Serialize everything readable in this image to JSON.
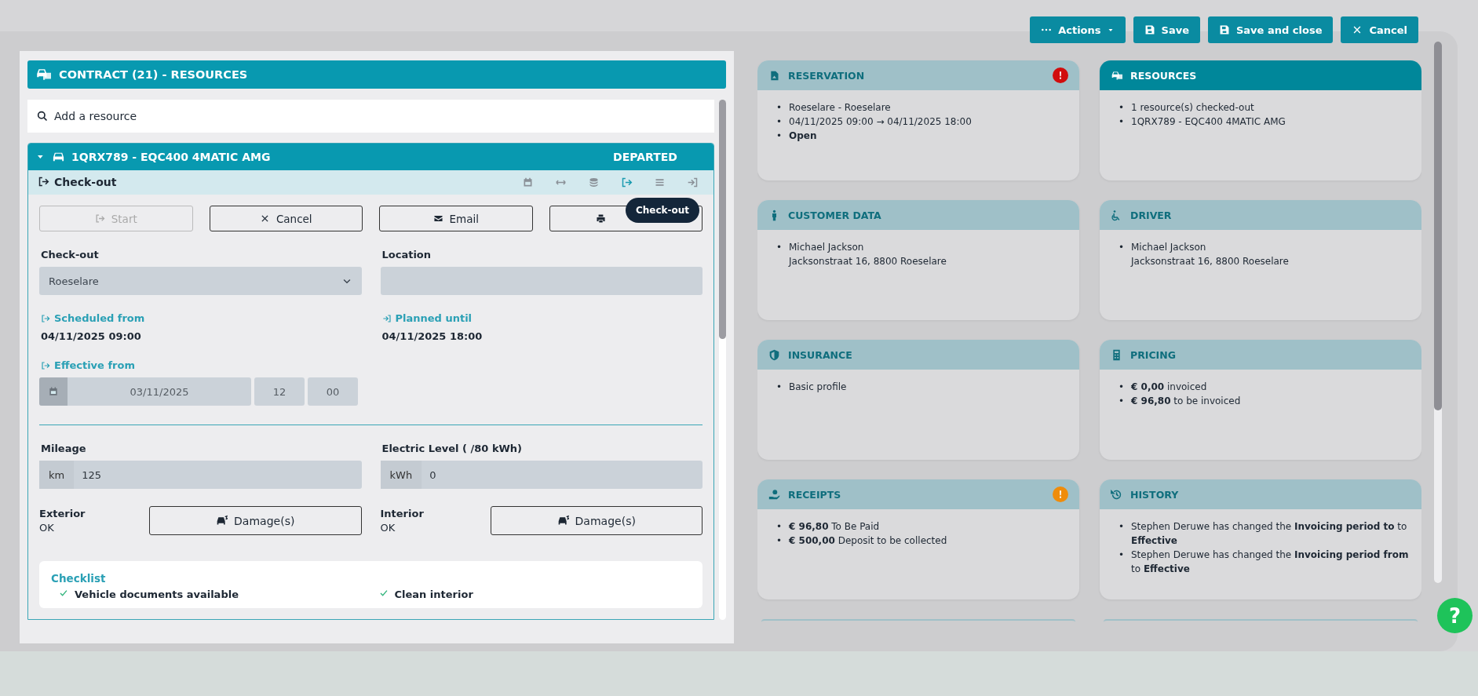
{
  "toolbar": {
    "buttons": [
      {
        "label": "Actions",
        "kind": "actions"
      },
      {
        "label": "Save",
        "kind": "save"
      },
      {
        "label": "Save and close",
        "kind": "save"
      },
      {
        "label": "Cancel",
        "kind": "cancel"
      }
    ]
  },
  "resources_panel": {
    "title": "CONTRACT (21) - RESOURCES",
    "search": {
      "placeholder": "Add a resource"
    },
    "resource": {
      "title": "1QRX789 - EQC400 4MATIC AMG",
      "status": "DEPARTED",
      "expanded": true,
      "section_title": "Check-out",
      "tools": [
        {
          "kind": "calendar",
          "selected": false
        },
        {
          "kind": "resize",
          "selected": false
        },
        {
          "kind": "coins",
          "selected": false
        },
        {
          "kind": "checkout",
          "selected": true
        },
        {
          "kind": "list",
          "selected": false
        },
        {
          "kind": "checkin",
          "selected": false
        }
      ],
      "actions": [
        {
          "label": "Start",
          "kind": "start",
          "disabled": true
        },
        {
          "label": "Cancel",
          "kind": "cancel",
          "disabled": false
        },
        {
          "label": "Email",
          "kind": "email",
          "disabled": false
        },
        {
          "kind": "print",
          "disabled": false
        }
      ],
      "tooltip": "Check-out",
      "checkout_location": {
        "label": "Check-out",
        "value": "Roeselare"
      },
      "location": {
        "label": "Location"
      },
      "scheduled_from": {
        "label": "Scheduled from",
        "value": "04/11/2025 09:00"
      },
      "planned_until": {
        "label": "Planned until",
        "value": "04/11/2025 18:00"
      },
      "effective_from": {
        "label": "Effective from",
        "date": "03/11/2025",
        "hour": "12",
        "minute": "00"
      },
      "mileage": {
        "label": "Mileage",
        "unit": "km",
        "value": "125"
      },
      "electric_level": {
        "label": "Electric Level ( /80 kWh)",
        "unit": "kWh",
        "value": "0"
      },
      "damages": [
        {
          "label": "Exterior",
          "value": "OK",
          "button": "Damage(s)"
        },
        {
          "label": "Interior",
          "value": "OK",
          "button": "Damage(s)"
        }
      ],
      "checklist": {
        "title": "Checklist",
        "items": [
          {
            "label": "Vehicle documents available",
            "checked": true
          },
          {
            "label": "Clean interior",
            "checked": true
          }
        ]
      }
    }
  },
  "cards": [
    {
      "title": "RESERVATION",
      "highlighted": false,
      "alert": true,
      "color": "#d10d0d",
      "items": [
        {
          "bullet": "•",
          "text": "Roeselare - Roeselare",
          "bold": false
        },
        {
          "bullet": "•",
          "text": "04/11/2025 09:00 → 04/11/2025 18:00",
          "bold": false
        },
        {
          "bullet": "•",
          "text": "Open",
          "bold": true
        }
      ]
    },
    {
      "title": "RESOURCES",
      "highlighted": true,
      "alert": false,
      "items": [
        {
          "bullet": "•",
          "text": "1 resource(s) checked-out",
          "bold": false
        },
        {
          "bullet": "•",
          "text": "1QRX789 - EQC400 4MATIC AMG",
          "bold": false
        }
      ]
    },
    {
      "title": "CUSTOMER DATA",
      "highlighted": false,
      "alert": false,
      "items": [
        {
          "bullet": "•",
          "text": "Michael Jackson",
          "detail": "Jacksonstraat 16, 8800 Roeselare",
          "bold": false
        }
      ]
    },
    {
      "title": "DRIVER",
      "highlighted": false,
      "alert": false,
      "items": [
        {
          "bullet": "•",
          "text": "Michael Jackson",
          "detail": "Jacksonstraat 16, 8800 Roeselare",
          "bold": false
        }
      ]
    },
    {
      "title": "INSURANCE",
      "highlighted": false,
      "alert": false,
      "items": [
        {
          "bullet": "•",
          "text": "Basic profile",
          "bold": false
        }
      ]
    },
    {
      "title": "PRICING",
      "highlighted": false,
      "alert": false,
      "items": [
        {
          "bullet": "•",
          "text": "**€ 0,00** invoiced",
          "bold": false
        },
        {
          "bullet": "•",
          "text": "**€ 96,80** to be invoiced",
          "bold": false
        }
      ]
    },
    {
      "title": "RECEIPTS",
      "highlighted": false,
      "alert": true,
      "color": "#ef8c0b",
      "items": [
        {
          "bullet": "•",
          "text": "**€ 96,80** To Be Paid",
          "bold": false
        },
        {
          "bullet": "•",
          "text": "**€ 500,00** Deposit to be collected",
          "bold": false
        }
      ]
    },
    {
      "title": "HISTORY",
      "highlighted": false,
      "alert": false,
      "items": [
        {
          "bullet": "•",
          "text": "Stephen Deruwe has changed the **Invoicing period to** to **Effective**",
          "bold": false
        },
        {
          "bullet": "•",
          "text": "Stephen Deruwe has changed the **Invoicing period from** to **Effective**",
          "bold": false
        }
      ]
    }
  ],
  "help_button": "?"
}
